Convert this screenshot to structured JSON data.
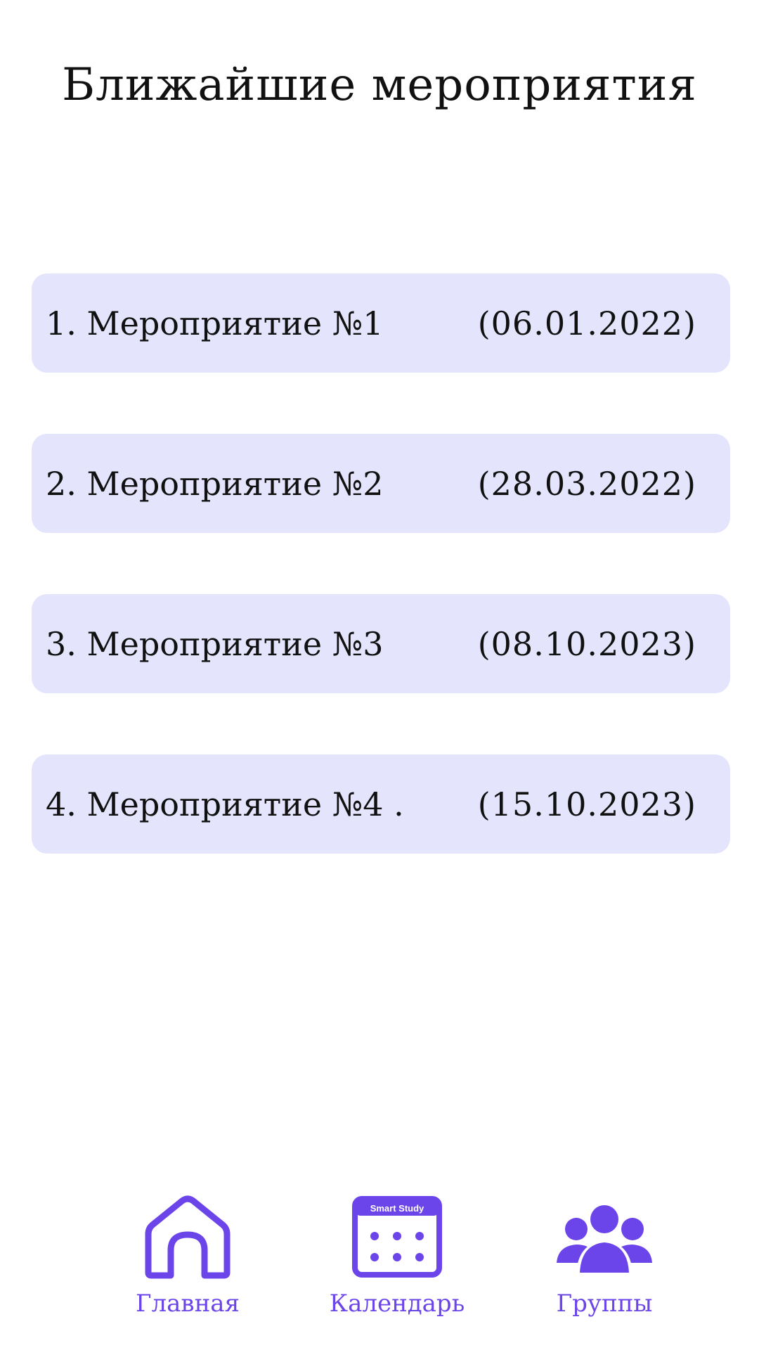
{
  "header": {
    "title": "Ближайшие мероприятия"
  },
  "events": [
    {
      "title": "1. Мероприятие №1",
      "date": "(06.01.2022)"
    },
    {
      "title": "2. Мероприятие №2",
      "date": "(28.03.2022)"
    },
    {
      "title": "3. Мероприятие №3",
      "date": "(08.10.2023)"
    },
    {
      "title": "4. Мероприятие №4 .",
      "date": "(15.10.2023)"
    }
  ],
  "nav": {
    "home": {
      "label": "Главная",
      "icon": "home-icon"
    },
    "calendar": {
      "label": "Календарь",
      "icon": "calendar-icon",
      "icon_text": "Smart Study"
    },
    "groups": {
      "label": "Группы",
      "icon": "groups-icon"
    }
  },
  "colors": {
    "accent": "#6b45ea",
    "card_bg": "#e4e4fd",
    "text": "#111111",
    "background": "#ffffff"
  }
}
